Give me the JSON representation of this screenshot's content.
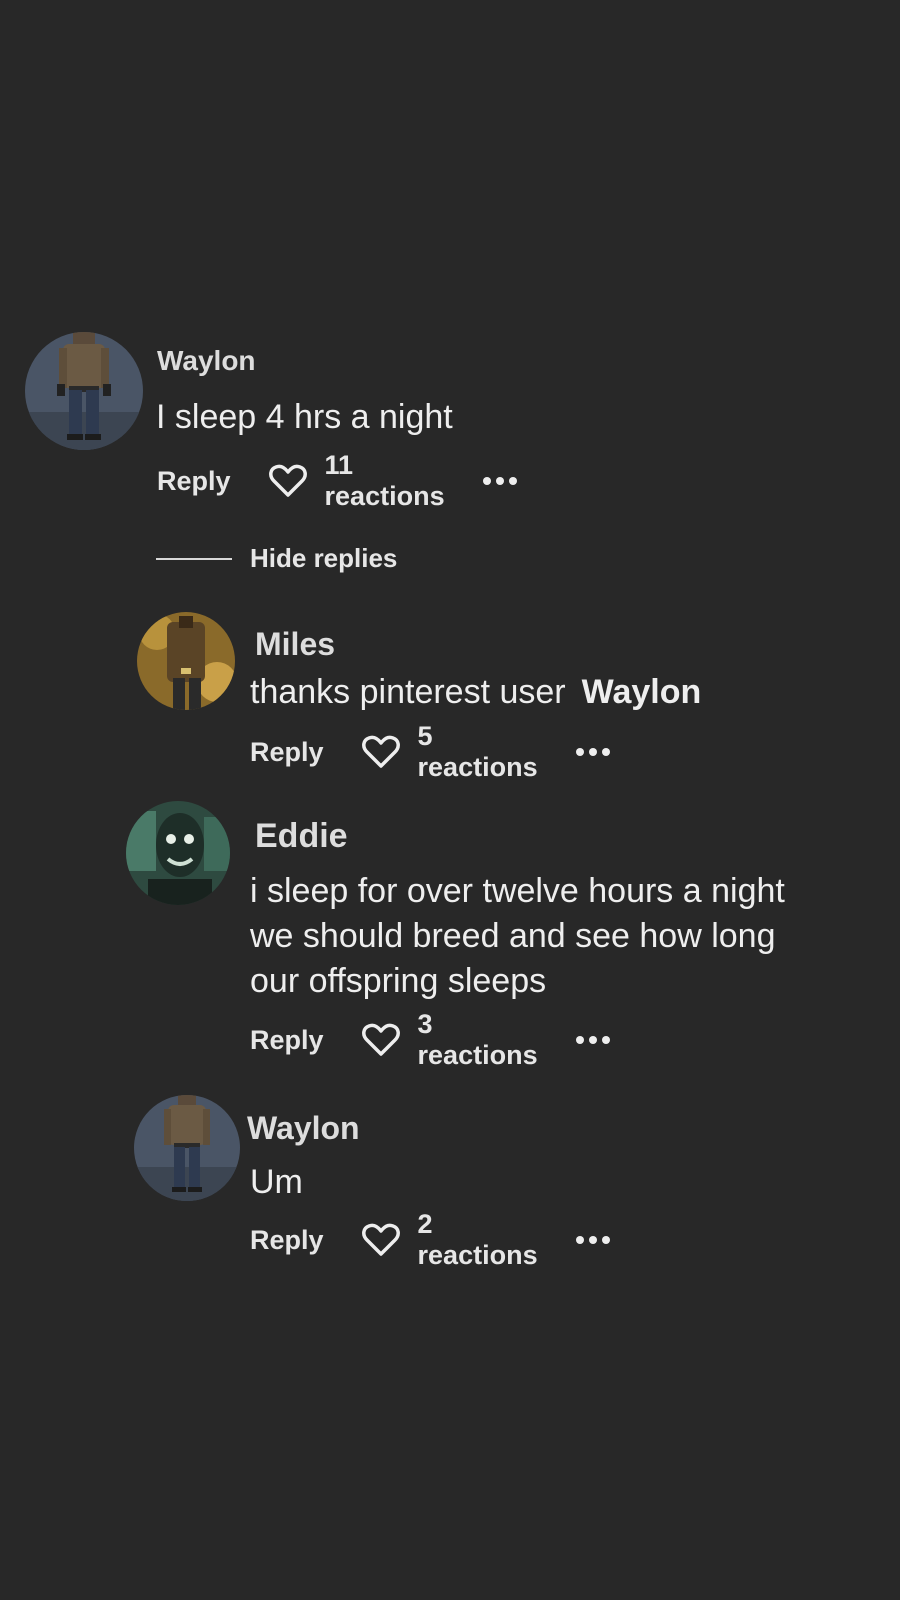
{
  "comments": [
    {
      "author": "Waylon",
      "text": "I sleep 4 hrs a night",
      "reply_label": "Reply",
      "reactions": "11 reactions"
    }
  ],
  "hide_replies_label": "Hide replies",
  "replies": [
    {
      "author": "Miles",
      "text": "thanks pinterest user",
      "mention": "Waylon",
      "reply_label": "Reply",
      "reactions": "5 reactions"
    },
    {
      "author": "Eddie",
      "text_lines": [
        "i sleep for over twelve hours a night",
        "we should breed and see how long",
        "our offspring sleeps"
      ],
      "reply_label": "Reply",
      "reactions": "3 reactions"
    },
    {
      "author": "Waylon",
      "text": "Um",
      "reply_label": "Reply",
      "reactions": "2 reactions"
    }
  ],
  "icons": {
    "heart": "heart-icon",
    "more": "more-options-icon"
  },
  "colors": {
    "background": "#282828",
    "text": "#eeeeee"
  }
}
